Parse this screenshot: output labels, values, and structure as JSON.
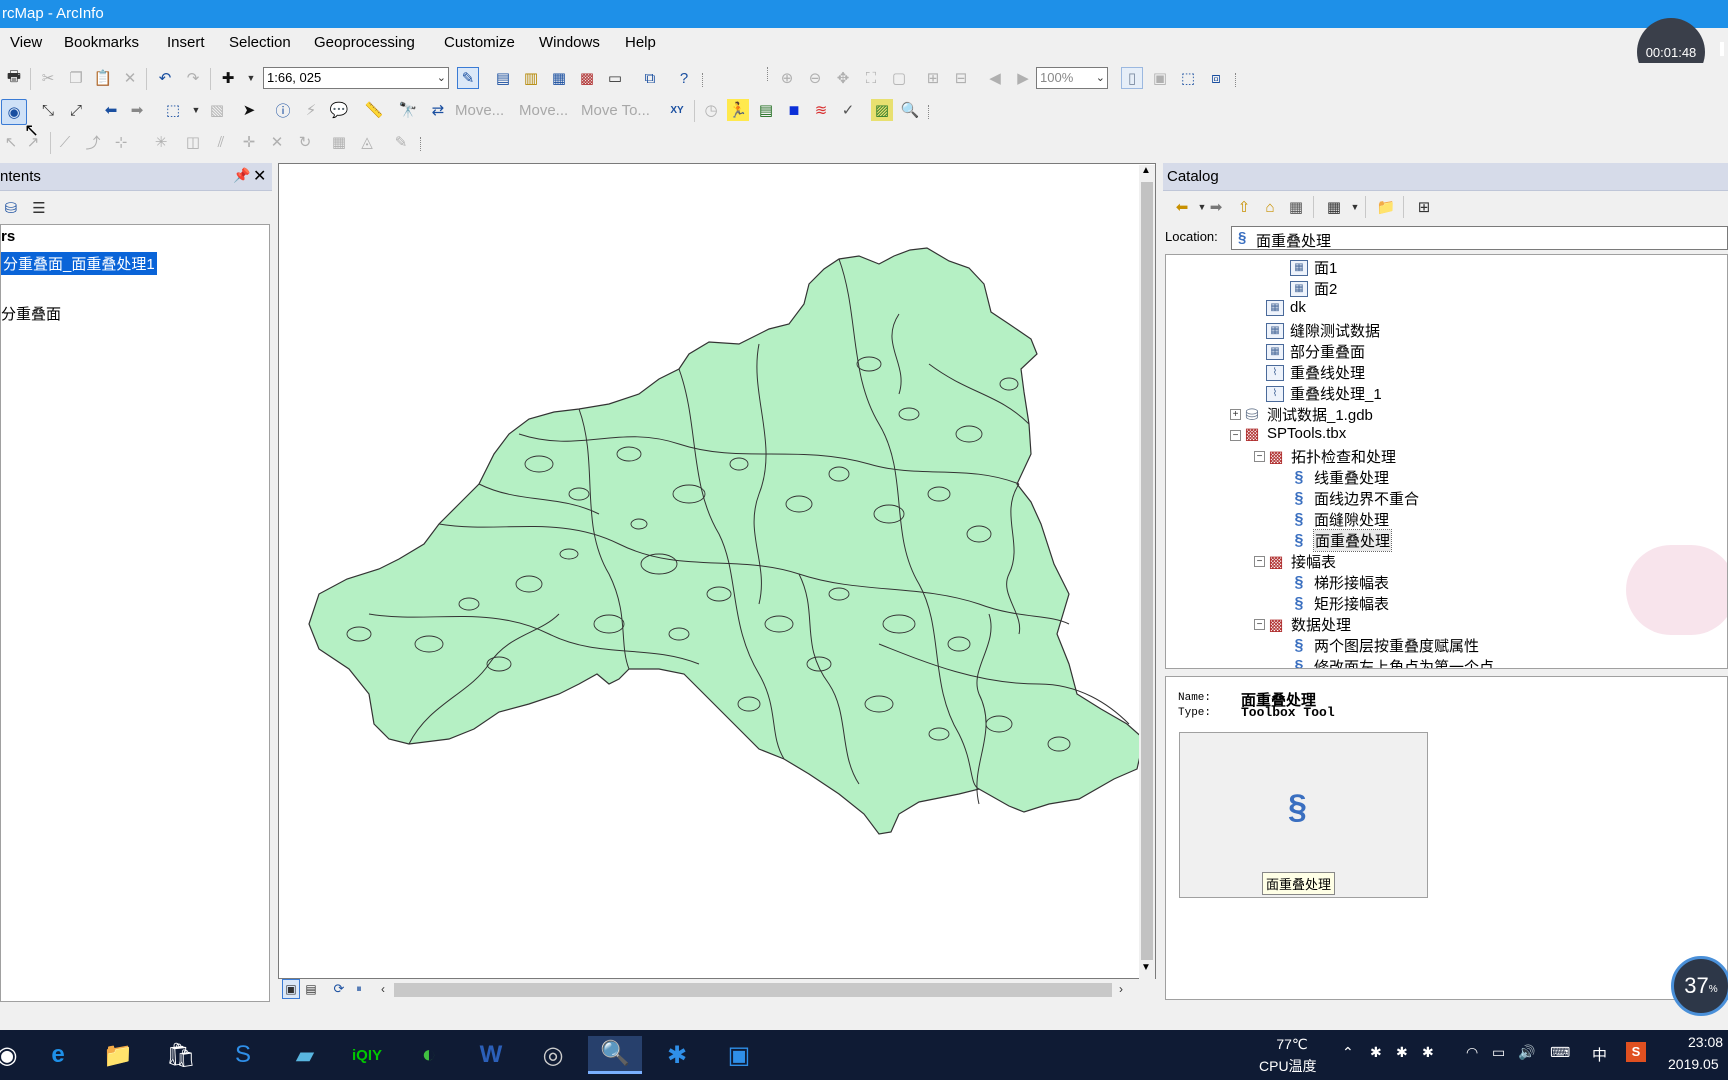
{
  "window": {
    "title": "rcMap - ArcInfo"
  },
  "recorder": {
    "time": "00:01:48"
  },
  "menu": [
    "View",
    "Bookmarks",
    "Insert",
    "Selection",
    "Geoprocessing",
    "Customize",
    "Windows",
    "Help"
  ],
  "toolbar": {
    "scale_value": "1:66, 025",
    "zoom_value": "100%",
    "move_buttons": [
      "Move...",
      "Move...",
      "Move To..."
    ],
    "xy_label": "XY"
  },
  "toc": {
    "title": "ntents",
    "layers_label": "rs",
    "items": [
      "分重叠面_面重叠处理1",
      "分重叠面"
    ]
  },
  "catalog": {
    "title": "Catalog",
    "location_label": "Location:",
    "location_value": "面重叠处理",
    "tree": [
      {
        "label": "面1",
        "kind": "fc"
      },
      {
        "label": "面2",
        "kind": "fc"
      },
      {
        "label": "dk",
        "kind": "fc"
      },
      {
        "label": "缝隙测试数据",
        "kind": "fc"
      },
      {
        "label": "部分重叠面",
        "kind": "fc"
      },
      {
        "label": "重叠线处理",
        "kind": "line"
      },
      {
        "label": "重叠线处理_1",
        "kind": "line"
      },
      {
        "label": "测试数据_1.gdb",
        "kind": "gdb"
      },
      {
        "label": "SPTools.tbx",
        "kind": "tbx"
      },
      {
        "label": "拓扑检查和处理",
        "kind": "toolset"
      },
      {
        "label": "线重叠处理",
        "kind": "tool"
      },
      {
        "label": "面线边界不重合",
        "kind": "tool"
      },
      {
        "label": "面缝隙处理",
        "kind": "tool"
      },
      {
        "label": "面重叠处理",
        "kind": "tool"
      },
      {
        "label": "接幅表",
        "kind": "toolset"
      },
      {
        "label": "梯形接幅表",
        "kind": "tool"
      },
      {
        "label": "矩形接幅表",
        "kind": "tool"
      },
      {
        "label": "数据处理",
        "kind": "toolset"
      },
      {
        "label": "两个图层按重叠度赋属性",
        "kind": "tool"
      },
      {
        "label": "修改面左上角点为第一个点",
        "kind": "tool"
      }
    ],
    "desc": {
      "name_label": "Name:",
      "name_value": "面重叠处理",
      "type_label": "Type:",
      "type_value": "Toolbox Tool",
      "thumb_caption": "面重叠处理"
    }
  },
  "taskbar": {
    "temp": "77℃",
    "temp_label": "CPU温度",
    "ime": "中",
    "time": "23:08",
    "date": "2019.05"
  },
  "overlay": {
    "cpu_percent": "37",
    "percent_sign": "%"
  },
  "colors": {
    "title_bar": "#1e90e8",
    "map_fill": "#b5f0c4",
    "map_stroke": "#333333",
    "taskbar": "#0f1b34",
    "selection": "#0a64d8"
  }
}
